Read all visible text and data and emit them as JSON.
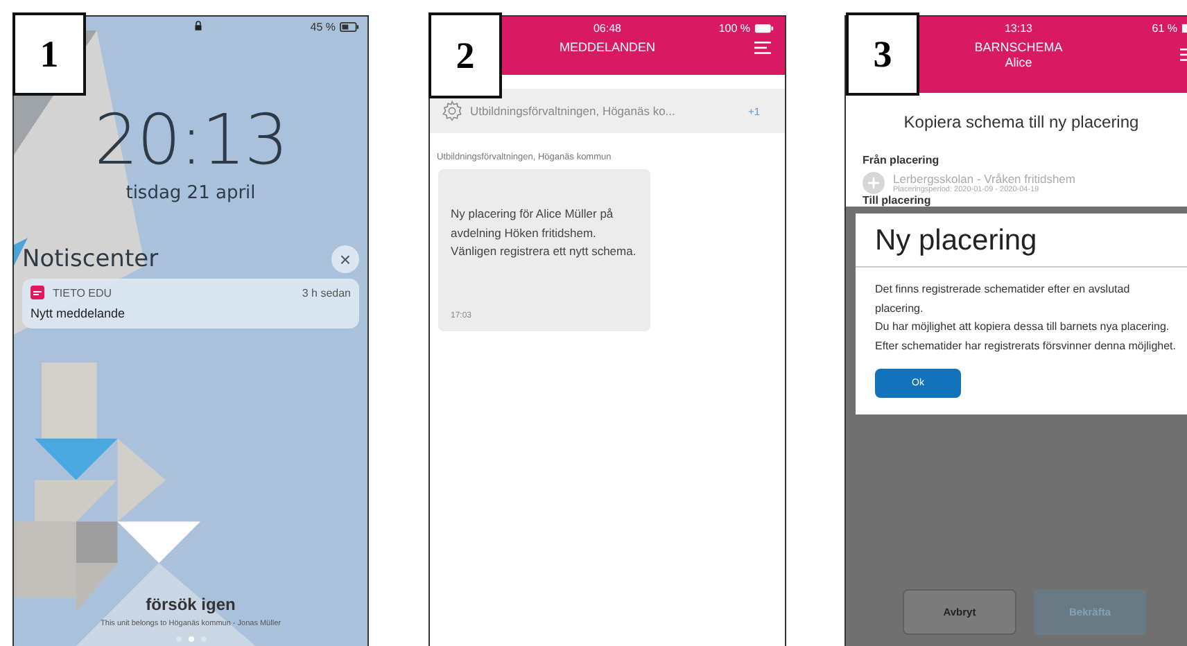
{
  "figure_labels": [
    "1",
    "2",
    "3"
  ],
  "lock_screen": {
    "battery": "45 %",
    "time": "20:13",
    "date": "tisdag 21 april",
    "notification_center": {
      "title": "Notiscenter",
      "close": "×",
      "notification": {
        "app": "TIETO EDU",
        "age": "3 h sedan",
        "text": "Nytt meddelande"
      }
    },
    "prompt": "försök igen",
    "owner": "This unit belongs to Höganäs kommun - Jonas Müller",
    "page_dots": [
      {
        "selected": false
      },
      {
        "selected": true
      },
      {
        "selected": false
      }
    ]
  },
  "messages_screen": {
    "time": "06:48",
    "battery": "100 %",
    "title": "MEDDELANDEN",
    "thread": {
      "name": "Utbildningsförvaltningen, Höganäs ko...",
      "count": "+1"
    },
    "sender": "Utbildningsförvaltningen, Höganäs kommun",
    "message": {
      "text": "Ny placering för Alice Müller på avdelning Höken fritidshem. Vänligen registrera ett nytt schema.",
      "time": "17:03"
    }
  },
  "schedule_screen": {
    "time": "13:13",
    "battery": "61 %",
    "title": "BARNSCHEMA",
    "subtitle": "Alice",
    "heading": "Kopiera schema till ny placering",
    "from_label": "Från placering",
    "from_item": {
      "name": "Lerbergsskolan - Vråken fritidshem",
      "period": "Placeringsperiod: 2020-01-09 - 2020-04-19"
    },
    "to_label": "Till placering",
    "dialog": {
      "title": "Ny placering",
      "paragraphs": [
        "Det finns registrerade schematider efter en avslutad placering.",
        "Du har möjlighet att kopiera dessa till barnets nya placering.",
        "Efter schematider har registrerats försvinner denna möjlighet."
      ],
      "button": "Ok"
    },
    "actions": [
      {
        "label": "Avbryt",
        "disabled": false
      },
      {
        "label": "Bekräfta",
        "disabled": true
      }
    ]
  }
}
